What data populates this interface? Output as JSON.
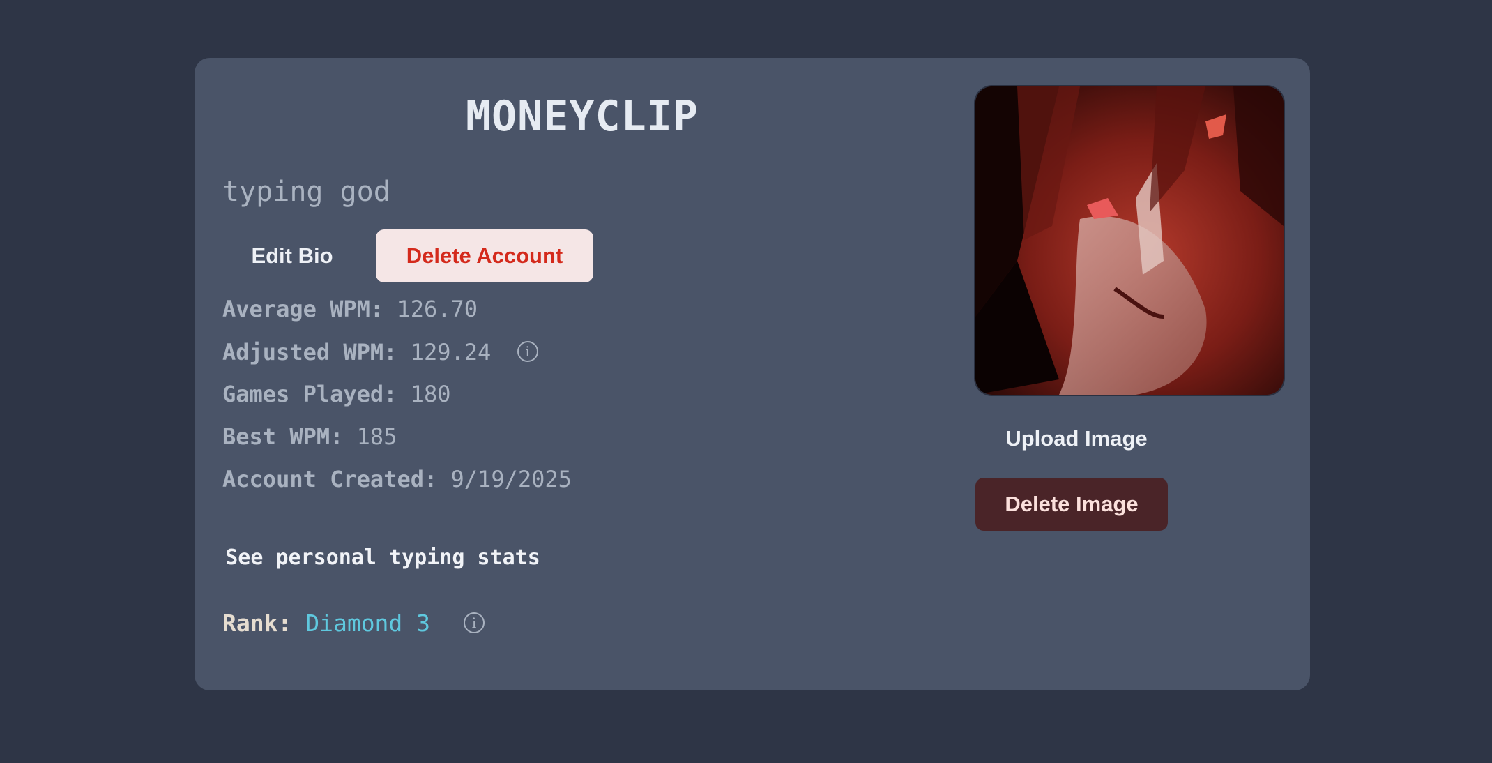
{
  "profile": {
    "username": "MONEYCLIP",
    "bio": "typing god",
    "edit_bio_label": "Edit Bio",
    "delete_account_label": "Delete Account",
    "upload_image_label": "Upload Image",
    "delete_image_label": "Delete Image",
    "avatar_icon": "profile-picture"
  },
  "stats": {
    "average_wpm": {
      "label": "Average WPM:",
      "value": "126.70"
    },
    "adjusted_wpm": {
      "label": "Adjusted WPM:",
      "value": "129.24",
      "info_glyph": "ⓘ"
    },
    "games_played": {
      "label": "Games Played:",
      "value": "180"
    },
    "best_wpm": {
      "label": "Best WPM:",
      "value": "185"
    },
    "account_created": {
      "label": "Account Created:",
      "value": "9/19/2025"
    }
  },
  "links": {
    "personal_stats": "See personal typing stats"
  },
  "rank": {
    "label": "Rank:",
    "value": "Diamond 3",
    "info_glyph": "ⓘ",
    "color": "#5fc8de"
  },
  "colors": {
    "page_bg": "#2e3546",
    "card_bg": "#4a5468",
    "danger": "#d42a1c",
    "danger_bg_light": "#f5e6e6",
    "danger_bg_dark": "#4a2428"
  }
}
